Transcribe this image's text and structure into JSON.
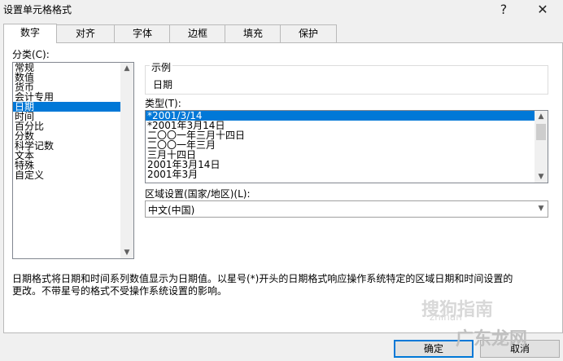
{
  "window": {
    "title": "设置单元格格式",
    "help": "?",
    "close": "✕"
  },
  "tabs": [
    "数字",
    "对齐",
    "字体",
    "边框",
    "填充",
    "保护"
  ],
  "category": {
    "label": "分类(C):",
    "items": [
      "常规",
      "数值",
      "货币",
      "会计专用",
      "日期",
      "时间",
      "百分比",
      "分数",
      "科学记数",
      "文本",
      "特殊",
      "自定义"
    ],
    "selected_index": 4
  },
  "sample": {
    "label": "示例",
    "value": "日期"
  },
  "type": {
    "label": "类型(T):",
    "items": [
      "*2001/3/14",
      "*2001年3月14日",
      "二〇〇一年三月十四日",
      "二〇〇一年三月",
      "三月十四日",
      "2001年3月14日",
      "2001年3月"
    ],
    "selected_index": 0
  },
  "locale": {
    "label": "区域设置(国家/地区)(L):",
    "value": "中文(中国)"
  },
  "description": {
    "line1": "日期格式将日期和时间系列数值显示为日期值。以星号(*)开头的日期格式响应操作系统特定的区域日期和时间设置的",
    "line2": "更改。不带星号的格式不受操作系统设置的影响。"
  },
  "buttons": {
    "ok": "确定",
    "cancel": "取消"
  },
  "watermark": {
    "text1": "搜狗指南",
    "text2": "zhinan",
    "text3": "广东龙网"
  },
  "colors": {
    "selection": "#0078d7"
  }
}
